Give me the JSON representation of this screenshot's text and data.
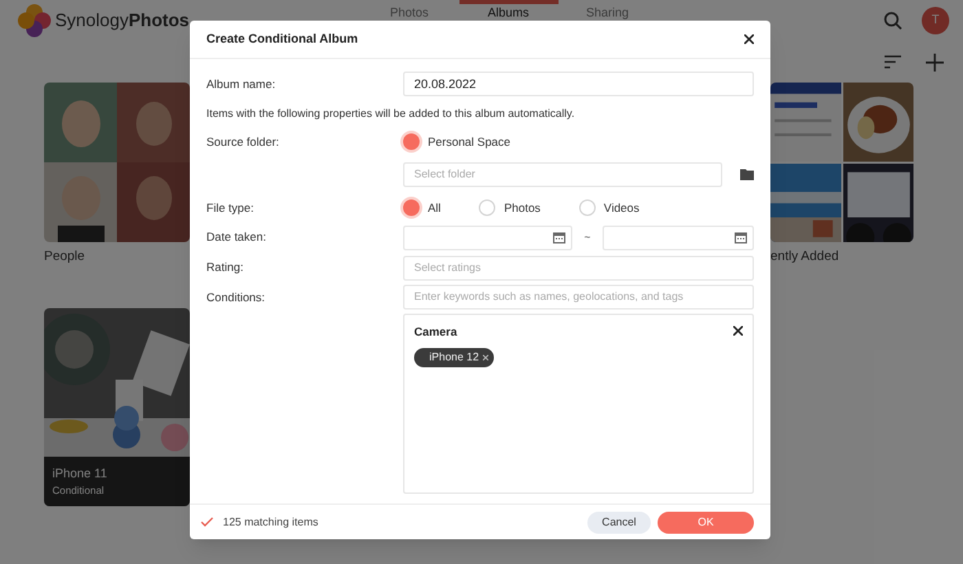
{
  "app": {
    "brand_light": "Synology",
    "brand_bold": "Photos",
    "avatar": "T",
    "tabs": [
      {
        "label": "Photos",
        "selected": false
      },
      {
        "label": "Albums",
        "selected": true
      },
      {
        "label": "Sharing",
        "selected": false
      }
    ],
    "albums": [
      {
        "title": "People",
        "kind": "faces"
      },
      {
        "title": "iPhone 11",
        "subtitle": "Conditional",
        "kind": "desk"
      }
    ],
    "right_album": {
      "title": "ently Added"
    }
  },
  "dialog": {
    "title": "Create Conditional Album",
    "album_name": {
      "label": "Album name:",
      "value": "20.08.2022"
    },
    "description": "Items with the following properties will be added to this album automatically.",
    "source_folder": {
      "label": "Source folder:",
      "options": [
        {
          "label": "Personal Space",
          "selected": true
        }
      ],
      "placeholder": "Select folder"
    },
    "file_type": {
      "label": "File type:",
      "options": [
        {
          "label": "All",
          "selected": true
        },
        {
          "label": "Photos",
          "selected": false
        },
        {
          "label": "Videos",
          "selected": false
        }
      ]
    },
    "date_taken": {
      "label": "Date taken:",
      "separator": "~"
    },
    "rating": {
      "label": "Rating:",
      "placeholder": "Select ratings"
    },
    "conditions": {
      "label": "Conditions:",
      "placeholder": "Enter keywords such as names, geolocations, and tags",
      "groups": [
        {
          "title": "Camera",
          "tags": [
            "iPhone 12"
          ]
        }
      ]
    },
    "footer": {
      "status": "125 matching items",
      "buttons": [
        {
          "label": "Cancel",
          "kind": "secondary"
        },
        {
          "label": "OK",
          "kind": "primary"
        }
      ]
    }
  }
}
